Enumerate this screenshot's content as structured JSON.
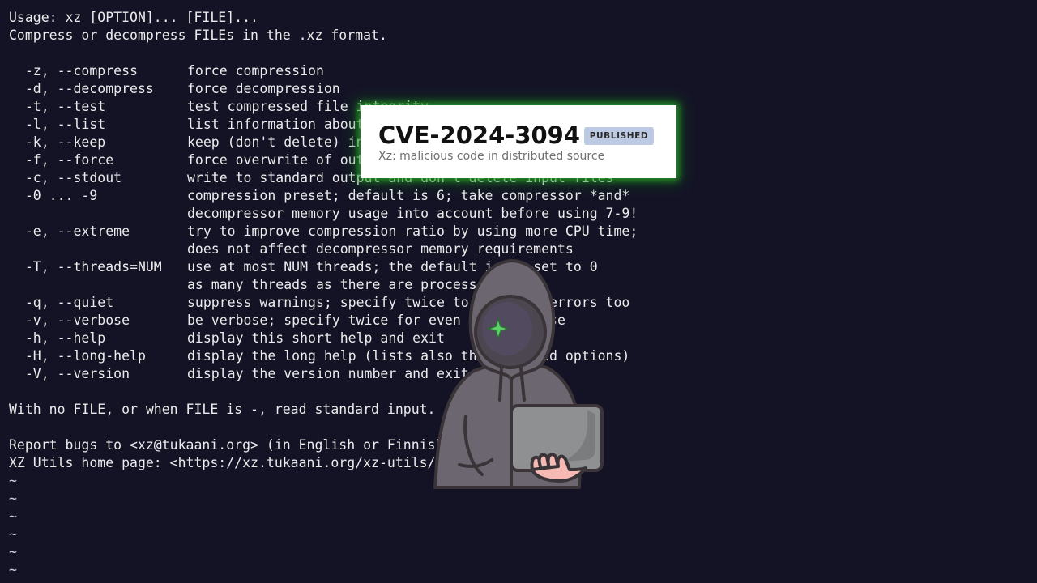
{
  "terminal": {
    "header_lines": [
      "Usage: xz [OPTION]... [FILE]...",
      "Compress or decompress FILEs in the .xz format."
    ],
    "options": [
      {
        "flag": "-z, --compress",
        "desc": "force compression"
      },
      {
        "flag": "-d, --decompress",
        "desc": "force decompression"
      },
      {
        "flag": "-t, --test",
        "desc": "test compressed file integrity"
      },
      {
        "flag": "-l, --list",
        "desc": "list information about .xz files"
      },
      {
        "flag": "-k, --keep",
        "desc": "keep (don't delete) input files"
      },
      {
        "flag": "-f, --force",
        "desc": "force overwrite of output file and (de)compress links"
      },
      {
        "flag": "-c, --stdout",
        "desc": "write to standard output and don't delete input files"
      },
      {
        "flag": "-0 ... -9",
        "desc": "compression preset; default is 6; take compressor *and*"
      },
      {
        "flag": "",
        "desc": "decompressor memory usage into account before using 7-9!"
      },
      {
        "flag": "-e, --extreme",
        "desc": "try to improve compression ratio by using more CPU time;"
      },
      {
        "flag": "",
        "desc": "does not affect decompressor memory requirements"
      },
      {
        "flag": "-T, --threads=NUM",
        "desc": "use at most NUM threads; the default is 1; set to 0"
      },
      {
        "flag": "",
        "desc": "as many threads as there are processor cores"
      },
      {
        "flag": "-q, --quiet",
        "desc": "suppress warnings; specify twice to suppress errors too"
      },
      {
        "flag": "-v, --verbose",
        "desc": "be verbose; specify twice for even more verbose"
      },
      {
        "flag": "-h, --help",
        "desc": "display this short help and exit"
      },
      {
        "flag": "-H, --long-help",
        "desc": "display the long help (lists also the advanced options)"
      },
      {
        "flag": "-V, --version",
        "desc": "display the version number and exit"
      }
    ],
    "stdin_note": "With no FILE, or when FILE is -, read standard input.",
    "bugs_line": "Report bugs to <xz@tukaani.org> (in English or Finnish).",
    "home_line": "XZ Utils home page: <https://xz.tukaani.org/xz-utils/>",
    "tildes": [
      "~",
      "~",
      "~",
      "~",
      "~",
      "~"
    ]
  },
  "cve_card": {
    "id": "CVE-2024-3094",
    "status": "PUBLISHED",
    "description": "Xz: malicious code in distributed source"
  },
  "hacker_figure": {
    "icon": "hooded-hacker-with-laptop-icon",
    "hoodie_color": "#6b6670",
    "eye_color": "#5fcf6b",
    "laptop_color": "#8e9092"
  }
}
